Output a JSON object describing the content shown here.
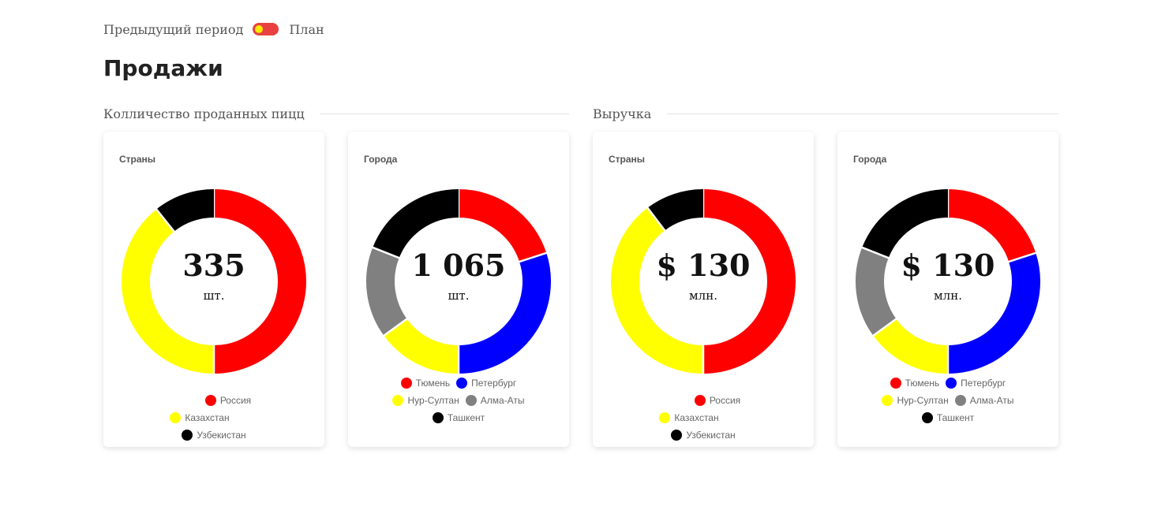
{
  "toggle": {
    "left_label": "Предыдущий период",
    "right_label": "План",
    "track_color": "#e8413f",
    "knob_color": "#ffea00"
  },
  "page_title": "Продажи",
  "sections": [
    {
      "title": "Колличество проданных пицц"
    },
    {
      "title": "Выручка"
    }
  ],
  "colors": {
    "Россия": "#ff0000",
    "Казахстан": "#ffff00",
    "Узбекистан": "#000000",
    "Тюмень": "#ff0000",
    "Петербург": "#0000ff",
    "Нур-Султан": "#ffff00",
    "Алма-Аты": "#808080",
    "Ташкент": "#000000"
  },
  "chart_data": [
    {
      "type": "pie",
      "title": "Страны",
      "center_value": "335",
      "center_unit": "шт.",
      "labels": [
        "Россия",
        "Казахстан",
        "Узбекистан"
      ],
      "values": [
        50,
        39.3,
        10.7
      ]
    },
    {
      "type": "pie",
      "title": "Города",
      "center_value": "1 065",
      "center_unit": "шт.",
      "labels": [
        "Тюмень",
        "Петербург",
        "Нур-Султан",
        "Алма-Аты",
        "Ташкент"
      ],
      "values": [
        20,
        30,
        15,
        16,
        19
      ]
    },
    {
      "type": "pie",
      "title": "Страны",
      "center_value": "$ 130",
      "center_unit": "млн.",
      "labels": [
        "Россия",
        "Казахстан",
        "Узбекистан"
      ],
      "values": [
        50,
        39.7,
        10.3
      ]
    },
    {
      "type": "pie",
      "title": "Города",
      "center_value": "$ 130",
      "center_unit": "млн.",
      "labels": [
        "Тюмень",
        "Петербург",
        "Нур-Султан",
        "Алма-Аты",
        "Ташкент"
      ],
      "values": [
        20,
        30,
        15,
        16,
        19
      ]
    }
  ]
}
